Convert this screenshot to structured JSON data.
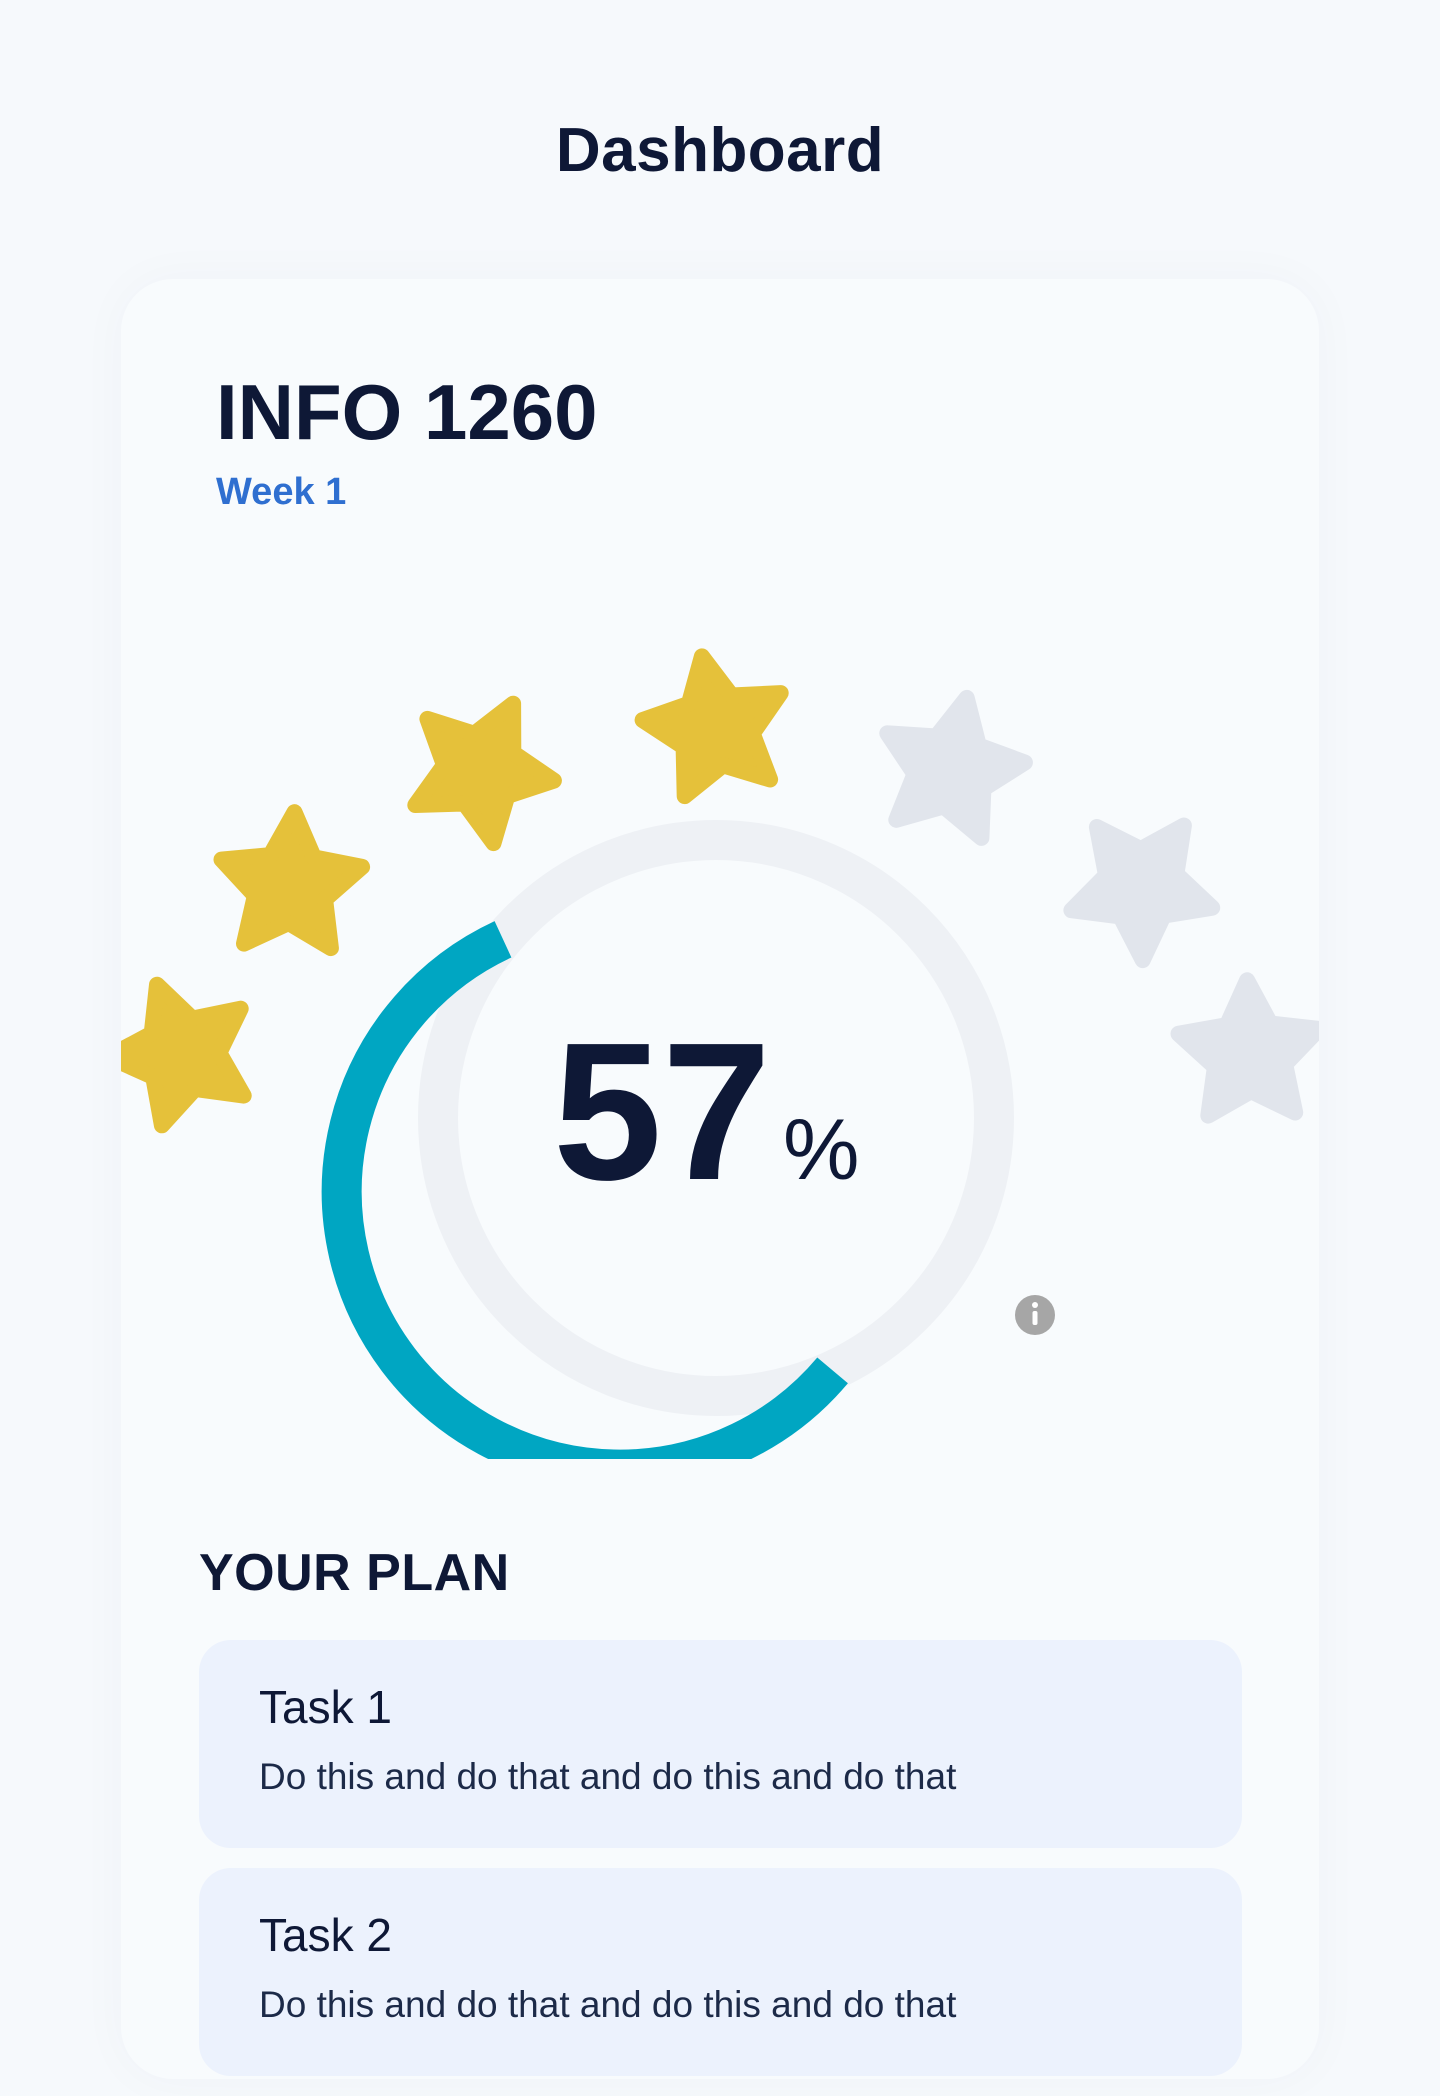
{
  "header": {
    "title": "Dashboard"
  },
  "course": {
    "code": "INFO 1260",
    "week": "Week 1"
  },
  "progress": {
    "value": "57",
    "unit": "%",
    "fraction": 0.57,
    "stars_total": 7,
    "stars_filled": 4
  },
  "plan": {
    "heading": "YOUR PLAN",
    "tasks": [
      {
        "title": "Task 1",
        "description": "Do this and do that and do this and do that"
      },
      {
        "title": "Task 2",
        "description": "Do this and do that and do this and do that"
      }
    ]
  },
  "colors": {
    "accent": "#00A6C2",
    "track": "#EEF1F5",
    "star_filled": "#E5C13A",
    "star_empty": "#E1E5EC",
    "week_link": "#2F6FD0",
    "text_dark": "#0E1836",
    "task_bg": "#ECF2FD",
    "info_icon": "#A6A6A6"
  },
  "icons": {
    "star": "star-icon",
    "info": "info-icon"
  }
}
